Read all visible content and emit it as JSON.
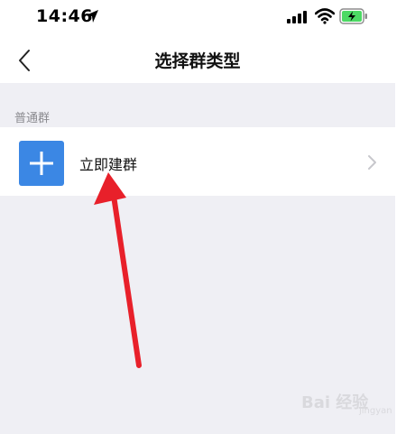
{
  "status_bar": {
    "time": "14:46"
  },
  "nav": {
    "title": "选择群类型"
  },
  "section": {
    "header": "普通群"
  },
  "items": [
    {
      "label": "立即建群"
    }
  ],
  "watermark": {
    "brand": "Bai 经验",
    "sub": "jingyan"
  },
  "colors": {
    "accent": "#3b87e4",
    "battery_fill": "#4cd964",
    "annotation_arrow": "#e8202a",
    "background": "#efeff4"
  }
}
